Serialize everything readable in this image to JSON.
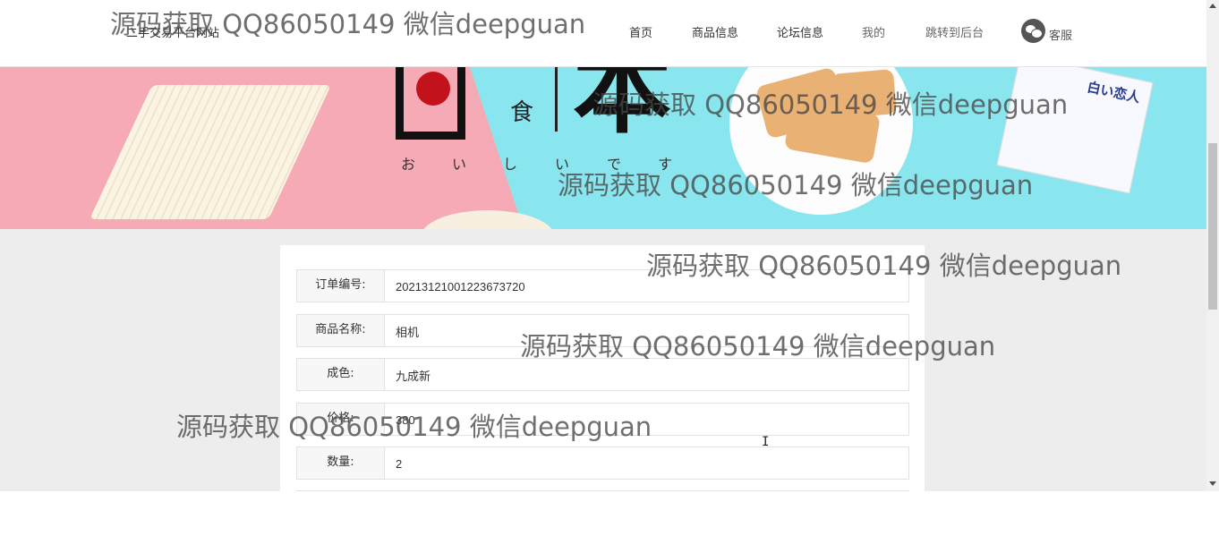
{
  "header": {
    "site_title": "二手交易平台网站",
    "nav": [
      "首页",
      "商品信息",
      "论坛信息",
      "我的",
      "跳转到后台"
    ],
    "service_label": "客服",
    "service_icon": "wechat-icon"
  },
  "banner": {
    "kanji_shoku": "食",
    "kanji_big": "本",
    "kana": [
      "お",
      "い",
      "し",
      "い",
      "で",
      "す"
    ],
    "pack_text": "白い恋人",
    "colors": {
      "pink": "#f5aab6",
      "cyan": "#8ae6ee",
      "red": "#c2121c"
    }
  },
  "form": {
    "fields": [
      {
        "label": "订单编号:",
        "value": "20213121001223673720"
      },
      {
        "label": "商品名称:",
        "value": "相机"
      },
      {
        "label": "成色:",
        "value": "九成新"
      },
      {
        "label": "价格:",
        "value": "380"
      },
      {
        "label": "数量:",
        "value": "2"
      }
    ]
  },
  "watermark": "源码获取 QQ86050149 微信deepguan"
}
